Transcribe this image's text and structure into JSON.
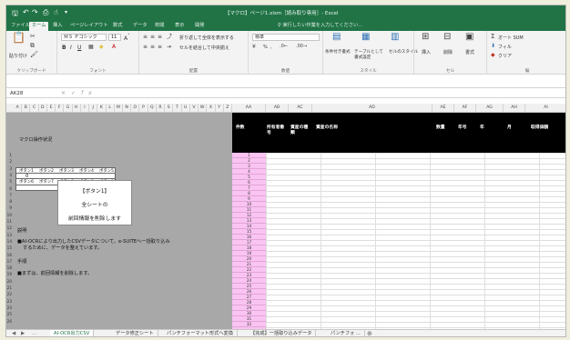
{
  "window": {
    "title": "【マクロ】ページ1.xlsm［読み取り専用］- Excel",
    "qat_icons": [
      "save-icon",
      "undo-icon",
      "redo-icon",
      "print-preview-icon",
      "touch-mode-icon"
    ]
  },
  "ribbon_tabs": [
    "ファイル",
    "ホーム",
    "挿入",
    "ページレイアウト",
    "数式",
    "データ",
    "校閲",
    "表示",
    "開発"
  ],
  "active_tab": "ホーム",
  "tell_me": "♀ 実行したい作業を入力してください...",
  "ribbon": {
    "clipboard": {
      "paste_label": "貼り付け",
      "group": "クリップボード"
    },
    "font": {
      "name": "ＭＳ Ｐゴシック",
      "size": "11",
      "bold": "B",
      "italic": "I",
      "underline": "U",
      "group": "フォント"
    },
    "alignment": {
      "wrap": "折り返して全体を表示する",
      "merge": "セルを結合して中央揃え",
      "group": "配置"
    },
    "number": {
      "format": "標準",
      "percent": "%",
      "comma": ",",
      "group": "数値"
    },
    "styles": {
      "cond": "条件付き書式",
      "table": "テーブルとして書式設定",
      "cell": "セルのスタイル",
      "group": "スタイル"
    },
    "cells": {
      "insert": "挿入",
      "delete": "削除",
      "format": "書式",
      "group": "セル"
    },
    "editing": {
      "autosum": "オート SUM",
      "fill": "フィル",
      "clear": "クリア",
      "group": "編"
    }
  },
  "formula_bar": {
    "name_box": "AK28",
    "fx": "fx",
    "cancel": "×",
    "enter": "✓",
    "value": ""
  },
  "col_headers_narrow": [
    "A",
    "B",
    "C",
    "D",
    "E",
    "F",
    "G",
    "H",
    "I",
    "J",
    "K",
    "L",
    "M",
    "N",
    "O",
    "P",
    "Q",
    "R",
    "S",
    "T",
    "U",
    "V",
    "W",
    "X",
    "Y",
    "Z"
  ],
  "col_headers_wide": [
    "AA",
    "AB",
    "AC",
    "AD",
    "AE",
    "AF",
    "AG",
    "AH",
    "AI"
  ],
  "left_panel": {
    "title": "マクロ操作状況",
    "buttons_row1": [
      "ボタン1",
      "ボタン2",
      "ボタン3",
      "ボタン4",
      "ボタン5"
    ],
    "status_row1": "0",
    "buttons_row2": [
      "ボタン6",
      "ボタン7",
      "ボタン8",
      "ボタン9",
      "ボタン10"
    ],
    "desc_heading": "説明",
    "desc_line1": "■AI-OCRにより出力したCSVデータについて、e-SUITEへ一括取り込み",
    "desc_line2": "するために、データを整えています。",
    "steps_heading": "手順",
    "steps_line1": "■まずは、前回情報を削除します。",
    "button_box": {
      "line1": "【ボタン1】",
      "line2": "全シートの",
      "line3": "前回情報を削除します"
    }
  },
  "row_numbers": [
    "1",
    "2",
    "3",
    "4",
    "5",
    "6",
    "7",
    "8",
    "9",
    "10",
    "11",
    "12",
    "13",
    "14",
    "15",
    "16",
    "17",
    "18",
    "19",
    "20",
    "21",
    "22",
    "23",
    "24",
    "25",
    "26"
  ],
  "table_headers": {
    "aa": "件数",
    "ab": "所有者番号",
    "ac": "資産の種類",
    "ad": "資産の名称",
    "ae": "数量",
    "af": "年号",
    "ag": "年",
    "ah": "月",
    "ai": "取得価額"
  },
  "count_values": [
    "1",
    "2",
    "3",
    "4",
    "5",
    "6",
    "7",
    "8",
    "9",
    "10",
    "11",
    "12",
    "13",
    "14",
    "15",
    "16",
    "17",
    "18",
    "19",
    "20",
    "21",
    "22",
    "23",
    "24",
    "25",
    "26",
    "27",
    "28",
    "29",
    "30",
    "31",
    "32"
  ],
  "sheet_tabs": [
    "AI-OCR出力CSV",
    "データ修正シート",
    "パンチフォーマット形式へ変換",
    "【完成】一括取り込みデータ",
    "パンチフォ ..."
  ],
  "active_sheet": "AI-OCR出力CSV",
  "colors": {
    "excel_green": "#217346",
    "header_black": "#000000",
    "pink": "#f9c4f1",
    "grey_panel": "#a8a8a8"
  }
}
